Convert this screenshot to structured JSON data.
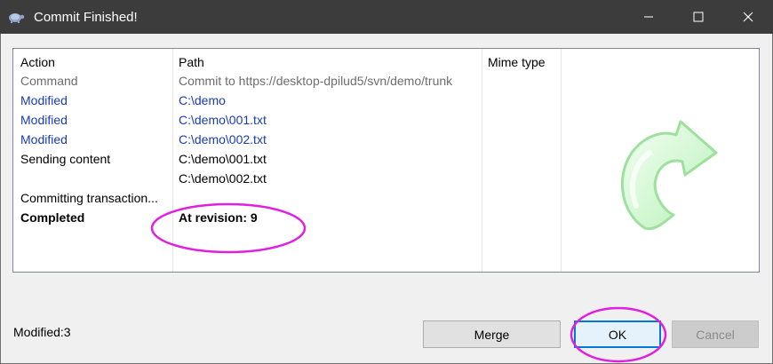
{
  "window": {
    "title": "Commit Finished!",
    "app_icon": "tortoise-icon",
    "controls": {
      "minimize": "minimize-icon",
      "maximize": "maximize-icon",
      "close": "close-icon"
    }
  },
  "list": {
    "headers": {
      "action": "Action",
      "path": "Path",
      "mime": "Mime type"
    },
    "rows": [
      {
        "action": "Command",
        "path": "Commit to https://desktop-dpilud5/svn/demo/trunk",
        "style": "gray"
      },
      {
        "action": "Modified",
        "path": "C:\\demo",
        "style": "blue"
      },
      {
        "action": "Modified",
        "path": "C:\\demo\\001.txt",
        "style": "blue"
      },
      {
        "action": "Modified",
        "path": "C:\\demo\\002.txt",
        "style": "blue"
      },
      {
        "action": "Sending content",
        "path": "C:\\demo\\001.txt",
        "style": "black"
      },
      {
        "action": "",
        "path": "C:\\demo\\002.txt",
        "style": "black"
      },
      {
        "action": "Committing transaction...",
        "path": "",
        "style": "black"
      },
      {
        "action": "Completed",
        "path": "At revision: 9",
        "style": "bold"
      }
    ]
  },
  "status": {
    "text": "Modified:3"
  },
  "buttons": {
    "merge": "Merge",
    "ok": "OK",
    "cancel": "Cancel"
  },
  "colors": {
    "accent": "#0078d7",
    "annotation": "#e020e0",
    "modified_text": "#1a3cb4"
  }
}
